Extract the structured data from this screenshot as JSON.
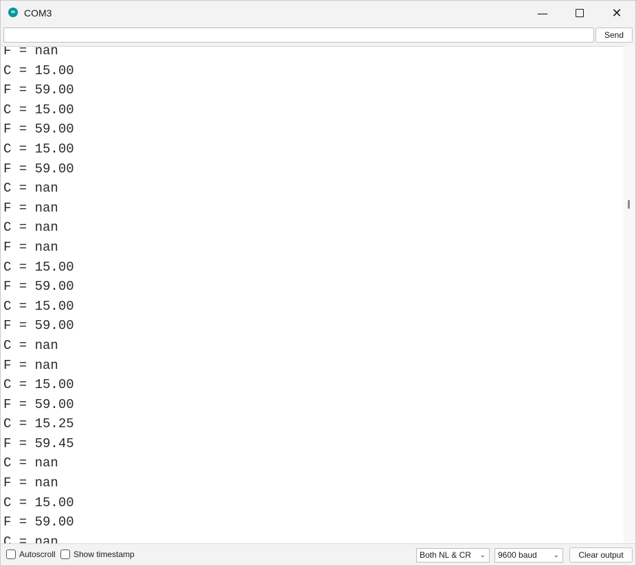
{
  "window": {
    "title": "COM3",
    "app_icon_glyph": "∞",
    "minimize_glyph": "—",
    "close_glyph": "✕"
  },
  "input_row": {
    "message_value": "",
    "send_label": "Send"
  },
  "output": {
    "lines": [
      "F = nan",
      "C = 15.00",
      "F = 59.00",
      "C = 15.00",
      "F = 59.00",
      "C = 15.00",
      "F = 59.00",
      "C = nan",
      "F = nan",
      "C = nan",
      "F = nan",
      "C = 15.00",
      "F = 59.00",
      "C = 15.00",
      "F = 59.00",
      "C = nan",
      "F = nan",
      "C = 15.00",
      "F = 59.00",
      "C = 15.25",
      "F = 59.45",
      "C = nan",
      "F = nan",
      "C = 15.00",
      "F = 59.00",
      "C = nan"
    ]
  },
  "bottom_bar": {
    "autoscroll_label": "Autoscroll",
    "timestamp_label": "Show timestamp",
    "line_ending": "Both NL & CR",
    "baud_rate": "9600 baud",
    "clear_label": "Clear output",
    "chevron_glyph": "⌄"
  },
  "colors": {
    "accent": "#00979d"
  }
}
